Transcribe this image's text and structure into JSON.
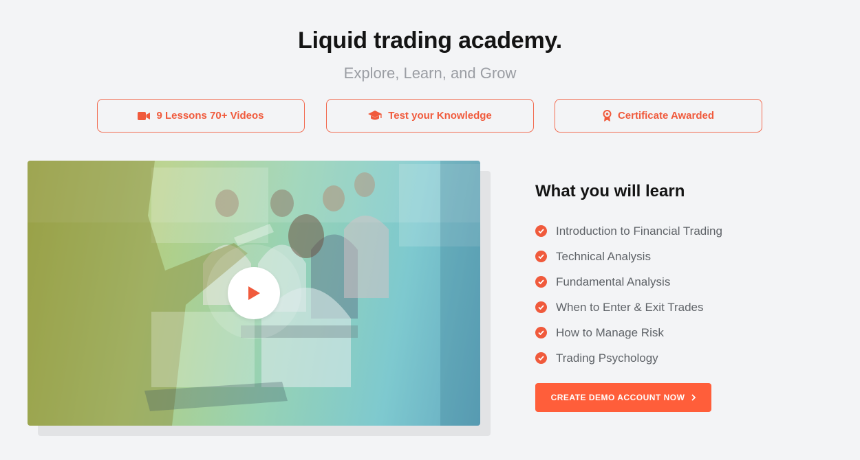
{
  "header": {
    "title": "Liquid trading academy.",
    "subtitle": "Explore, Learn, and Grow"
  },
  "features": [
    {
      "label": "9 Lessons 70+ Videos",
      "icon": "video-camera-icon"
    },
    {
      "label": "Test your Knowledge",
      "icon": "graduation-cap-icon"
    },
    {
      "label": "Certificate Awarded",
      "icon": "award-ribbon-icon"
    }
  ],
  "video": {
    "play_icon": "play-icon"
  },
  "learn": {
    "title": "What you will learn",
    "items": [
      "Introduction to Financial Trading",
      "Technical Analysis",
      "Fundamental Analysis",
      "When to Enter & Exit Trades",
      "How to Manage Risk",
      "Trading Psychology"
    ]
  },
  "cta": {
    "label": "CREATE DEMO ACCOUNT NOW",
    "icon": "chevron-right-icon"
  },
  "colors": {
    "accent": "#f05a3c",
    "cta_bg": "#ff5e3a",
    "page_bg": "#f3f4f6"
  }
}
